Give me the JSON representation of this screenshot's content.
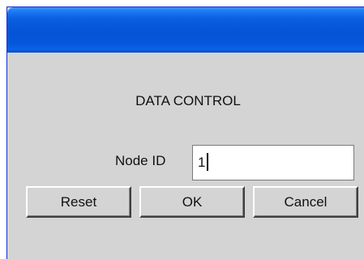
{
  "window": {
    "title": ""
  },
  "dialog": {
    "heading": "DATA CONTROL",
    "node_id_label": "Node ID",
    "node_id_value": "1"
  },
  "buttons": {
    "reset_label": "Reset",
    "ok_label": "OK",
    "cancel_label": "Cancel"
  },
  "colors": {
    "titlebar": "#0553d6",
    "dialog_background": "#d4d4d4",
    "input_background": "#ffffff"
  }
}
